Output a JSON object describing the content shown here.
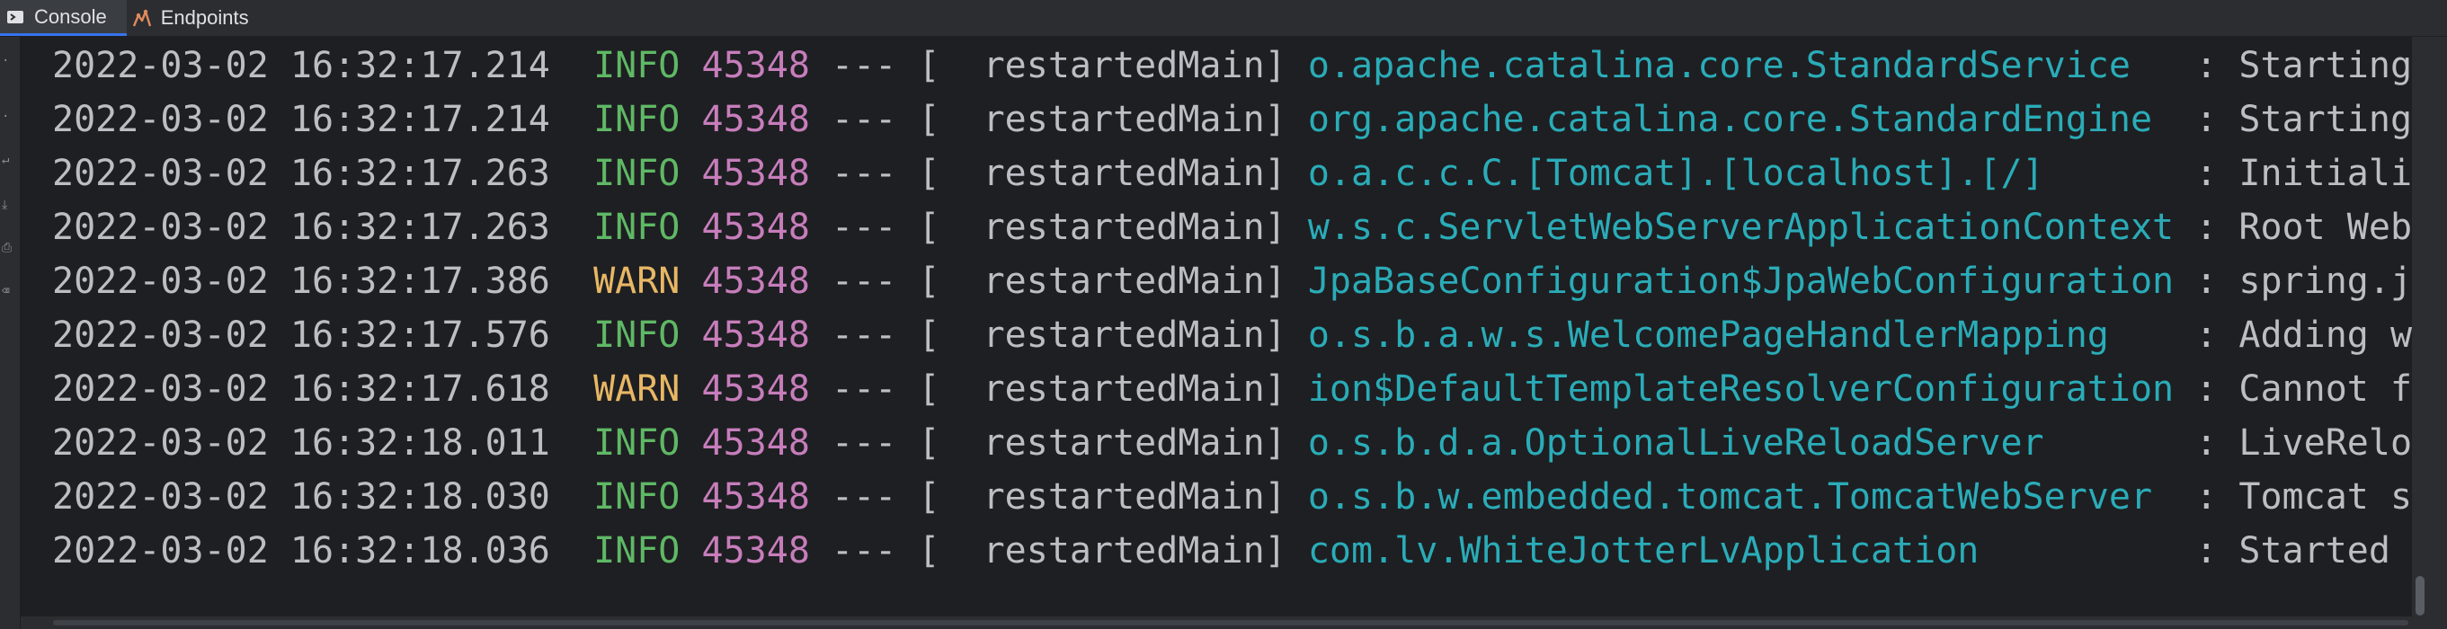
{
  "tabs": [
    {
      "label": "Console",
      "icon": "console-icon",
      "active": true
    },
    {
      "label": "Endpoints",
      "icon": "endpoints-icon",
      "active": false
    }
  ],
  "colors": {
    "info": "#5fb865",
    "warn": "#e8b765",
    "pid": "#c77dbb",
    "logger": "#2aacb8",
    "text": "#bcbec4",
    "background": "#1e1f22"
  },
  "log_lines": [
    {
      "timestamp": "2022-03-02 16:32:17.214",
      "level": "INFO",
      "pid": "45348",
      "sep": "---",
      "thread": "[  restartedMain]",
      "logger": "o.apache.catalina.core.StandardService  ",
      "message": " : Starting"
    },
    {
      "timestamp": "2022-03-02 16:32:17.214",
      "level": "INFO",
      "pid": "45348",
      "sep": "---",
      "thread": "[  restartedMain]",
      "logger": "org.apache.catalina.core.StandardEngine ",
      "message": " : Starting"
    },
    {
      "timestamp": "2022-03-02 16:32:17.263",
      "level": "INFO",
      "pid": "45348",
      "sep": "---",
      "thread": "[  restartedMain]",
      "logger": "o.a.c.c.C.[Tomcat].[localhost].[/]      ",
      "message": " : Initiali"
    },
    {
      "timestamp": "2022-03-02 16:32:17.263",
      "level": "INFO",
      "pid": "45348",
      "sep": "---",
      "thread": "[  restartedMain]",
      "logger": "w.s.c.ServletWebServerApplicationContext",
      "message": " : Root Web"
    },
    {
      "timestamp": "2022-03-02 16:32:17.386",
      "level": "WARN",
      "pid": "45348",
      "sep": "---",
      "thread": "[  restartedMain]",
      "logger": "JpaBaseConfiguration$JpaWebConfiguration",
      "message": " : spring.j"
    },
    {
      "timestamp": "2022-03-02 16:32:17.576",
      "level": "INFO",
      "pid": "45348",
      "sep": "---",
      "thread": "[  restartedMain]",
      "logger": "o.s.b.a.w.s.WelcomePageHandlerMapping   ",
      "message": " : Adding w"
    },
    {
      "timestamp": "2022-03-02 16:32:17.618",
      "level": "WARN",
      "pid": "45348",
      "sep": "---",
      "thread": "[  restartedMain]",
      "logger": "ion$DefaultTemplateResolverConfiguration",
      "message": " : Cannot f"
    },
    {
      "timestamp": "2022-03-02 16:32:18.011",
      "level": "INFO",
      "pid": "45348",
      "sep": "---",
      "thread": "[  restartedMain]",
      "logger": "o.s.b.d.a.OptionalLiveReloadServer      ",
      "message": " : LiveRelo"
    },
    {
      "timestamp": "2022-03-02 16:32:18.030",
      "level": "INFO",
      "pid": "45348",
      "sep": "---",
      "thread": "[  restartedMain]",
      "logger": "o.s.b.w.embedded.tomcat.TomcatWebServer ",
      "message": " : Tomcat s"
    },
    {
      "timestamp": "2022-03-02 16:32:18.036",
      "level": "INFO",
      "pid": "45348",
      "sep": "---",
      "thread": "[  restartedMain]",
      "logger": "com.lv.WhiteJotterLvApplication         ",
      "message": " : Started "
    }
  ]
}
